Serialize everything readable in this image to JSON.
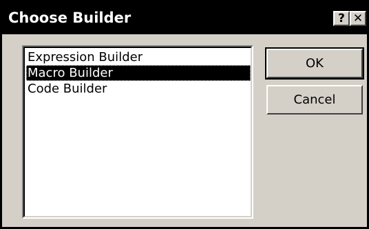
{
  "dialog": {
    "title": "Choose Builder",
    "help_button": "?",
    "close_button": "✕"
  },
  "list": {
    "items": [
      {
        "label": "Expression Builder",
        "selected": false
      },
      {
        "label": "Macro Builder",
        "selected": true
      },
      {
        "label": "Code Builder",
        "selected": false
      }
    ]
  },
  "buttons": {
    "ok_label": "OK",
    "cancel_label": "Cancel"
  },
  "colors": {
    "face": "#d4d0c8",
    "title_bar": "#000000",
    "selection": "#000000"
  }
}
